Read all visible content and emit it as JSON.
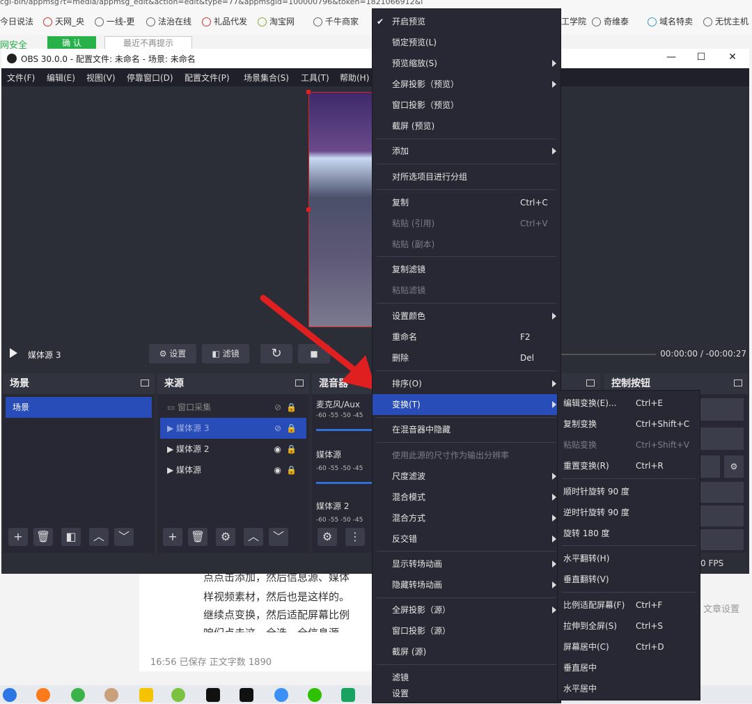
{
  "browser": {
    "url_fragment": "cgi-bin/appmsg?t=media/appmsg_edit&action=edit&type=77&appmsgid=100000796&token=1821066912&l",
    "bookmarks": [
      "今日说法",
      "天网_央",
      "一线-更",
      "法治在线",
      "礼品代发",
      "淘宝网",
      "千牛商家"
    ],
    "bookmarks_right": [
      "工学院",
      "奇维泰",
      "域名特卖",
      "无忧主机"
    ],
    "safety_label": "网安全",
    "confirm_button": "确 认",
    "dismiss_button": "最近不再提示"
  },
  "obs": {
    "title": "OBS 30.0.0 - 配置文件: 未命名 - 场景: 未命名",
    "menus": [
      "文件(F)",
      "编辑(E)",
      "视图(V)",
      "停靠窗口(D)",
      "配置文件(P)",
      "场景集合(S)",
      "工具(T)",
      "帮助(H)"
    ],
    "play": {
      "source_name": "媒体源 3",
      "settings_label": "设置",
      "filters_label": "滤镜",
      "time_elapsed": "00:00:00",
      "time_sep": "/",
      "time_total": "-00:00:27"
    },
    "docks": {
      "scenes": {
        "title": "场景",
        "items": [
          "场景"
        ]
      },
      "sources": {
        "title": "来源",
        "items": [
          "窗口采集",
          "媒体源 3",
          "媒体源 2",
          "媒体源"
        ]
      },
      "mixer": {
        "title": "混音器",
        "channels": [
          "麦克风/Aux",
          "媒体源",
          "媒体源 2"
        ],
        "scale": "-60 -55 -50 -45"
      },
      "controls": {
        "title": "控制按钮"
      }
    },
    "status_fps": "0 FPS"
  },
  "doc": {
    "lines": [
      "点点击添加，然后信息源、媒体",
      "样视频素材，然后也是这样的。",
      "继续点变换，然后适配屏幕比例",
      "咱们点击这，全选，全信息源"
    ],
    "status_time": "16:56",
    "status_saved": "已保存",
    "status_count": "正文字数 1890",
    "article_settings": "文章设置"
  },
  "context_menu": [
    {
      "label": "开启预览",
      "checked": true
    },
    {
      "label": "锁定预览(L)"
    },
    {
      "label": "预览缩放(S)",
      "submenu": true
    },
    {
      "label": "全屏投影（预览）",
      "submenu": true
    },
    {
      "label": "窗口投影（预览）"
    },
    {
      "label": "截屏 (预览)"
    },
    {
      "label": "添加",
      "submenu": true
    },
    {
      "label": "对所选项目进行分组"
    },
    {
      "label": "复制",
      "shortcut": "Ctrl+C"
    },
    {
      "label": "粘贴 (引用)",
      "shortcut": "Ctrl+V",
      "disabled": true
    },
    {
      "label": "粘贴 (副本)",
      "disabled": true
    },
    {
      "label": "复制滤镜"
    },
    {
      "label": "粘贴滤镜",
      "disabled": true
    },
    {
      "label": "设置颜色",
      "submenu": true
    },
    {
      "label": "重命名",
      "shortcut": "F2"
    },
    {
      "label": "删除",
      "shortcut": "Del"
    },
    {
      "label": "排序(O)",
      "submenu": true
    },
    {
      "label": "变换(T)",
      "submenu": true,
      "highlighted": true
    },
    {
      "label": "在混音器中隐藏"
    },
    {
      "label": "使用此源的尺寸作为输出分辨率",
      "disabled": true
    },
    {
      "label": "尺度滤波",
      "submenu": true
    },
    {
      "label": "混合模式",
      "submenu": true
    },
    {
      "label": "混合方式",
      "submenu": true
    },
    {
      "label": "反交错",
      "submenu": true
    },
    {
      "label": "显示转场动画",
      "submenu": true
    },
    {
      "label": "隐藏转场动画",
      "submenu": true
    },
    {
      "label": "全屏投影（源）",
      "submenu": true
    },
    {
      "label": "窗口投影（源）"
    },
    {
      "label": "截屏 (源)"
    },
    {
      "label": "滤镜"
    },
    {
      "label": "设置"
    }
  ],
  "transform_menu": [
    {
      "label": "编辑变换(E)...",
      "shortcut": "Ctrl+E"
    },
    {
      "label": "复制变换",
      "shortcut": "Ctrl+Shift+C"
    },
    {
      "label": "粘贴变换",
      "shortcut": "Ctrl+Shift+V",
      "disabled": true
    },
    {
      "label": "重置变换(R)",
      "shortcut": "Ctrl+R"
    },
    {
      "label": "顺时针旋转 90 度"
    },
    {
      "label": "逆时针旋转 90 度"
    },
    {
      "label": "旋转 180 度"
    },
    {
      "label": "水平翻转(H)"
    },
    {
      "label": "垂直翻转(V)"
    },
    {
      "label": "比例适配屏幕(F)",
      "shortcut": "Ctrl+F"
    },
    {
      "label": "拉伸到全屏(S)",
      "shortcut": "Ctrl+S"
    },
    {
      "label": "屏幕居中(C)",
      "shortcut": "Ctrl+D"
    },
    {
      "label": "垂直居中"
    },
    {
      "label": "水平居中"
    }
  ],
  "colors": {
    "accent": "#284cb8",
    "annotation": "#e02020",
    "panel": "#272833"
  }
}
